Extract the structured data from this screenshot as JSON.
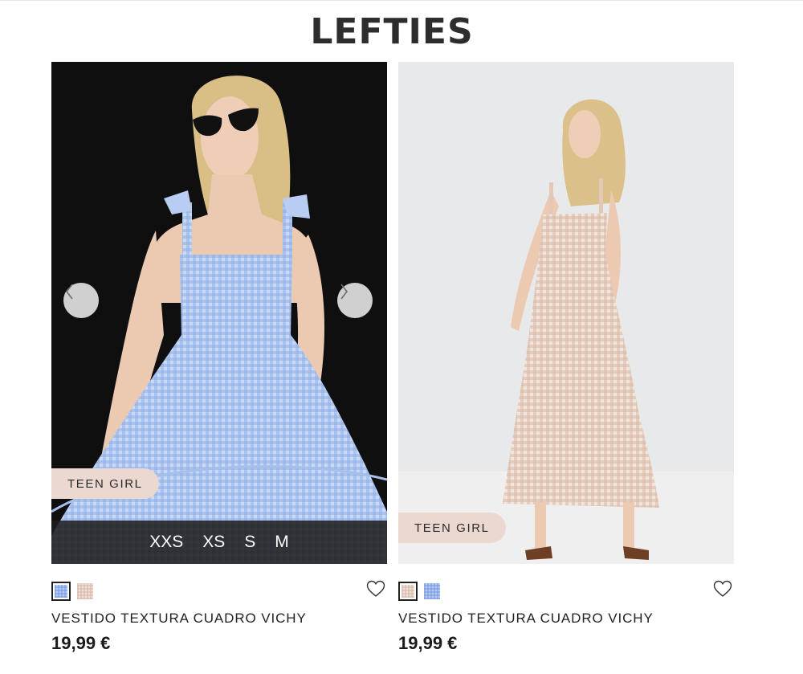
{
  "brand": "LEFTIES",
  "products": [
    {
      "badge": "TEEN GIRL",
      "sizes": [
        "XXS",
        "XS",
        "S",
        "M"
      ],
      "swatches": [
        "blue-gingham",
        "pink-gingham"
      ],
      "name": "VESTIDO TEXTURA CUADRO VICHY",
      "price": "19,99 €",
      "prev_icon": "chevron-left-icon",
      "next_icon": "chevron-right-icon",
      "fav_icon": "heart-icon"
    },
    {
      "badge": "TEEN GIRL",
      "swatches": [
        "pink-gingham",
        "blue-gingham"
      ],
      "name": "VESTIDO TEXTURA CUADRO VICHY",
      "price": "19,99 €",
      "fav_icon": "heart-icon"
    }
  ],
  "colors": {
    "badge_bg": "#ead8d1",
    "size_bar_bg": "#1e1e1e",
    "photo1_bg": "#0f0f0f",
    "photo2_bg": "#e8e9ea"
  }
}
